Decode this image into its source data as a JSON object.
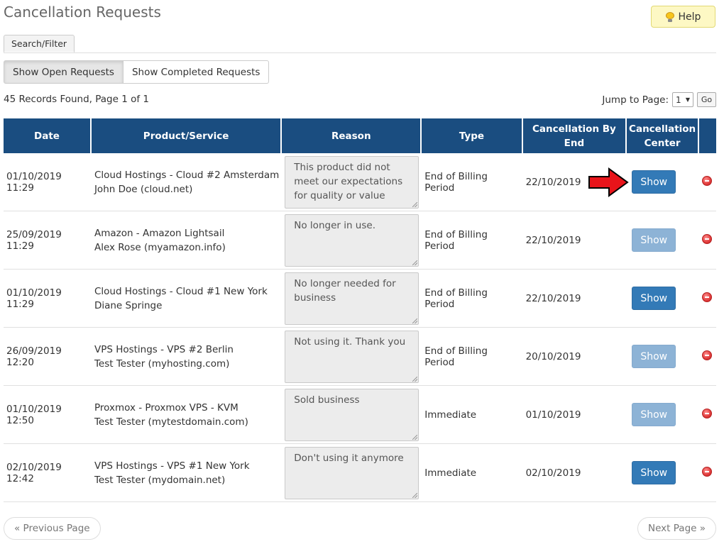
{
  "page": {
    "title": "Cancellation Requests"
  },
  "help": {
    "label": "Help",
    "icon": "lightbulb-icon"
  },
  "tabs": [
    {
      "label": "Search/Filter"
    }
  ],
  "toggles": {
    "open": "Show Open Requests",
    "completed": "Show Completed Requests"
  },
  "records": {
    "summary": "45 Records Found, Page 1 of 1"
  },
  "jump": {
    "label": "Jump to Page:",
    "value": "1",
    "go": "Go"
  },
  "table": {
    "headers": {
      "date": "Date",
      "product": "Product/Service",
      "reason": "Reason",
      "type": "Type",
      "end": "Cancellation By End",
      "center_line1": "Cancellation",
      "center_line2": "Center"
    },
    "rows": [
      {
        "date": "01/10/2019 11:29",
        "product": "Cloud Hostings - Cloud #2 Amsterdam",
        "client": "John Doe (cloud.net)",
        "reason": "This product did not meet our expectations for quality or value",
        "type": "End of Billing Period",
        "end": "22/10/2019",
        "show": "Show",
        "show_enabled": true
      },
      {
        "date": "25/09/2019 11:29",
        "product": "Amazon - Amazon Lightsail",
        "client": "Alex Rose (myamazon.info)",
        "reason": "No longer in use.",
        "type": "End of Billing Period",
        "end": "22/10/2019",
        "show": "Show",
        "show_enabled": false
      },
      {
        "date": "01/10/2019 11:29",
        "product": "Cloud Hostings - Cloud #1 New York",
        "client": "Diane Springe",
        "reason": "No longer needed for business",
        "type": "End of Billing Period",
        "end": "22/10/2019",
        "show": "Show",
        "show_enabled": true
      },
      {
        "date": "26/09/2019 12:20",
        "product": "VPS Hostings - VPS #2 Berlin",
        "client": "Test Tester (myhosting.com)",
        "reason": "Not using it. Thank you",
        "type": "End of Billing Period",
        "end": "20/10/2019",
        "show": "Show",
        "show_enabled": false
      },
      {
        "date": "01/10/2019 12:50",
        "product": "Proxmox - Proxmox VPS - KVM",
        "client": "Test Tester (mytestdomain.com)",
        "reason": "Sold business",
        "type": "Immediate",
        "end": "01/10/2019",
        "show": "Show",
        "show_enabled": false
      },
      {
        "date": "02/10/2019 12:42",
        "product": "VPS Hostings - VPS #1 New York",
        "client": "Test Tester (mydomain.net)",
        "reason": "Don't using it anymore",
        "type": "Immediate",
        "end": "02/10/2019",
        "show": "Show",
        "show_enabled": true
      }
    ]
  },
  "pager": {
    "prev": "« Previous Page",
    "next": "Next Page »"
  },
  "colors": {
    "header_bg": "#1a4d80",
    "show_enabled": "#337ab7",
    "show_disabled": "#8db3d6",
    "arrow": "#e8141a"
  }
}
